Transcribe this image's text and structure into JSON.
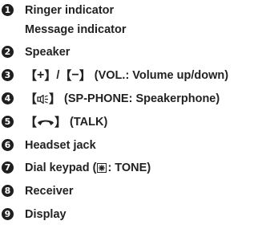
{
  "items": [
    {
      "num": "1",
      "lines": [
        "Ringer indicator",
        "Message indicator"
      ]
    },
    {
      "num": "2",
      "text": "Speaker"
    },
    {
      "num": "3",
      "key_plus": "+",
      "key_minus": "−",
      "separator": "/",
      "text": "(VOL.: Volume up/down)"
    },
    {
      "num": "4",
      "key_icon": "speakerphone-icon",
      "text": "(SP-PHONE: Speakerphone)"
    },
    {
      "num": "5",
      "key_icon": "handset-icon",
      "text": "(TALK)"
    },
    {
      "num": "6",
      "text": "Headset jack"
    },
    {
      "num": "7",
      "text_before": "Dial keypad (",
      "text_after": ": TONE)",
      "key_icon": "tone-star-key-icon"
    },
    {
      "num": "8",
      "text": "Receiver"
    },
    {
      "num": "9",
      "text": "Display"
    }
  ],
  "brackets": {
    "open": "【",
    "close": "】"
  }
}
